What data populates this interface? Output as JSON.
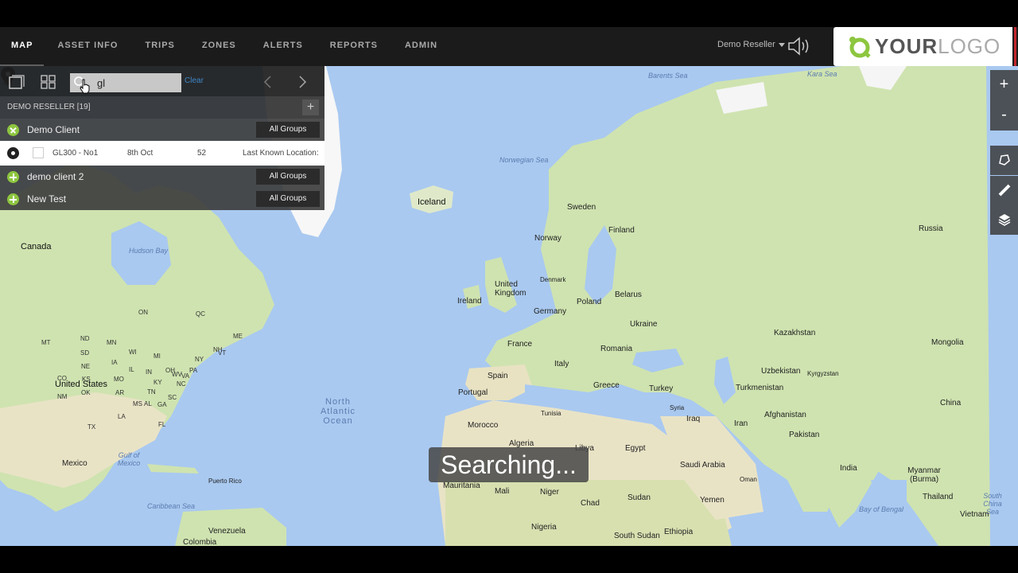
{
  "nav": {
    "items": [
      "MAP",
      "ASSET INFO",
      "TRIPS",
      "ZONES",
      "ALERTS",
      "REPORTS",
      "ADMIN"
    ],
    "active_index": 0,
    "reseller_label": "Demo Reseller"
  },
  "logo": {
    "text_bold": "YOUR",
    "text_light": "LOGO"
  },
  "panel": {
    "search_value": "gl",
    "clear_label": "Clear",
    "reseller_title": "DEMO RESELLER [19]",
    "add_label": "+",
    "clients": [
      {
        "name": "Demo Client",
        "group_button": "All Groups",
        "expanded": true
      },
      {
        "name": "demo client 2",
        "group_button": "All Groups",
        "expanded": false
      },
      {
        "name": "New Test",
        "group_button": "All Groups",
        "expanded": false
      }
    ],
    "device": {
      "name": "GL300 - No1",
      "date": "8th Oct",
      "value": "52",
      "location": "Last Known Location:"
    }
  },
  "map": {
    "zoom_in": "+",
    "zoom_out": "-",
    "status_overlay": "Searching...",
    "labels": {
      "barents_sea": "Barents Sea",
      "kara_sea": "Kara Sea",
      "norwegian_sea": "Norwegian Sea",
      "iceland": "Iceland",
      "sweden": "Sweden",
      "finland": "Finland",
      "norway": "Norway",
      "russia": "Russia",
      "canada": "Canada",
      "hudson_bay": "Hudson Bay",
      "united_kingdom": "United Kingdom",
      "ireland": "Ireland",
      "denmark": "Denmark",
      "belarus": "Belarus",
      "poland": "Poland",
      "germany": "Germany",
      "ukraine": "Ukraine",
      "kazakhstan": "Kazakhstan",
      "mongolia": "Mongolia",
      "france": "France",
      "romania": "Romania",
      "italy": "Italy",
      "uzbekistan": "Uzbekistan",
      "kyrgyzstan": "Kyrgyzstan",
      "spain": "Spain",
      "turkmenistan": "Turkmenistan",
      "greece": "Greece",
      "turkey": "Turkey",
      "portugal": "Portugal",
      "united_states": "United States",
      "north_atlantic_ocean": "North Atlantic Ocean",
      "syria": "Syria",
      "afghanistan": "Afghanistan",
      "tunisia": "Tunisia",
      "iraq": "Iraq",
      "iran": "Iran",
      "china": "China",
      "morocco": "Morocco",
      "pakistan": "Pakistan",
      "algeria": "Algeria",
      "libya": "Libya",
      "egypt": "Egypt",
      "saudi_arabia": "Saudi Arabia",
      "india": "India",
      "mexico": "Mexico",
      "gulf_of_mexico": "Gulf of Mexico",
      "oman": "Oman",
      "myanmar": "Myanmar (Burma)",
      "puerto_rico": "Puerto Rico",
      "mauritania": "Mauritania",
      "mali": "Mali",
      "niger": "Niger",
      "sudan": "Sudan",
      "yemen": "Yemen",
      "thailand": "Thailand",
      "caribbean_sea": "Caribbean Sea",
      "chad": "Chad",
      "bay_of_bengal": "Bay of Bengal",
      "south_china_sea": "South China Sea",
      "vietnam": "Vietnam",
      "venezuela": "Venezuela",
      "nigeria": "Nigeria",
      "ethiopia": "Ethiopia",
      "colombia": "Colombia",
      "south_sudan": "South Sudan",
      "states": [
        "ON",
        "QC",
        "MT",
        "ND",
        "MN",
        "WI",
        "MI",
        "ME",
        "NY",
        "PA",
        "SD",
        "NE",
        "IA",
        "IL",
        "OH",
        "KS",
        "MO",
        "TN",
        "OK",
        "AR",
        "NC",
        "TX",
        "LA",
        "GA",
        "FL",
        "NH",
        "VT",
        "CO",
        "NM",
        "MS",
        "AL",
        "SC",
        "VA",
        "KY",
        "IN",
        "WV"
      ]
    }
  }
}
